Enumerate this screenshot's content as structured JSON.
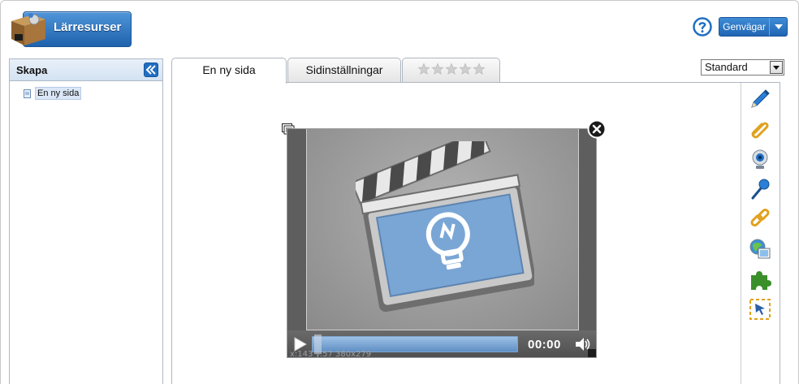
{
  "header": {
    "logo_text": "Lärresurser",
    "shortcuts_label": "Genvägar"
  },
  "left_panel": {
    "title": "Skapa",
    "items": [
      {
        "label": "En ny sida"
      }
    ]
  },
  "tabs": [
    {
      "label": "En ny sida",
      "active": true
    },
    {
      "label": "Sidinställningar",
      "active": false
    },
    {
      "label": "",
      "rating": 0,
      "rating_max": 5
    }
  ],
  "view_select": {
    "value": "Standard"
  },
  "video": {
    "time": "00:00",
    "status_readout": "x:143 y:57 380x279"
  },
  "toolbar": {
    "tools": [
      "pencil-icon",
      "paperclip-icon",
      "webcam-icon",
      "microphone-icon",
      "link-icon",
      "image-icon",
      "puzzle-icon",
      "select-icon"
    ]
  },
  "colors": {
    "accent": "#1f6fc2",
    "panel_header": "#dce8f5",
    "tool_orange": "#e0a11d",
    "tool_blue": "#1f6fc2",
    "tool_green": "#3a8f2a"
  }
}
